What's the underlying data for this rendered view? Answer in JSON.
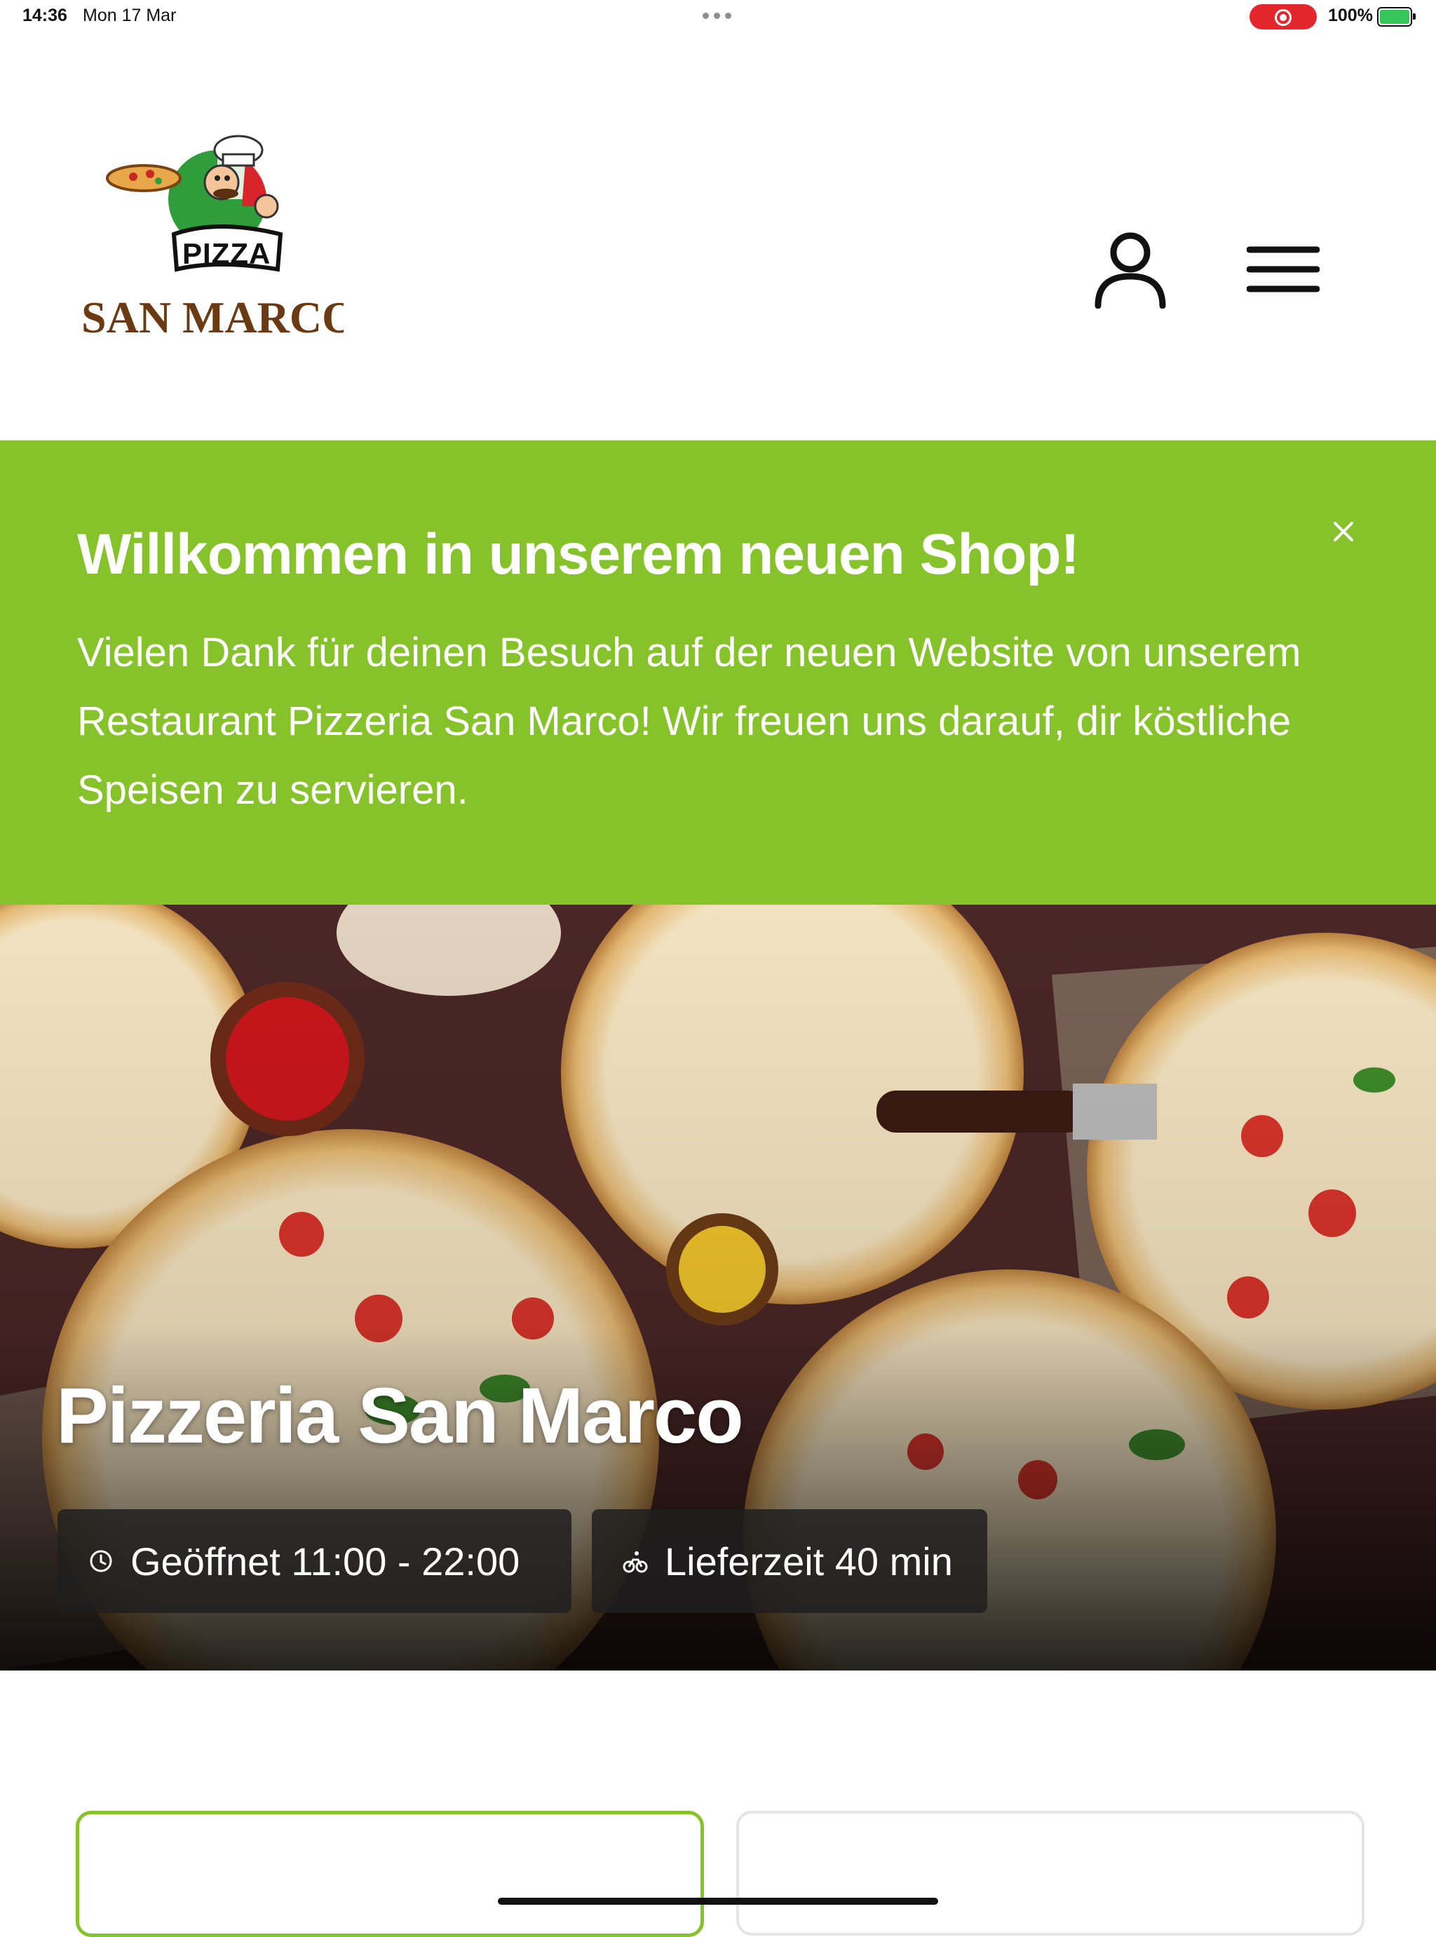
{
  "status_bar": {
    "time": "14:36",
    "date": "Mon 17 Mar",
    "battery": "100%"
  },
  "header": {
    "logo": {
      "top_text": "PIZZA",
      "bottom_text": "SAN MARCO"
    },
    "account_icon": "user-icon",
    "menu_icon": "hamburger-menu-icon"
  },
  "banner": {
    "title": "Willkommen in unserem neuen Shop!",
    "text": "Vielen Dank für deinen Besuch auf der neuen Website von unserem Restaurant Pizzeria San Marco! Wir freuen uns darauf, dir köstliche Speisen zu servieren.",
    "close_icon": "close-icon",
    "background": "#86c22a"
  },
  "hero": {
    "title": "Pizzeria San Marco",
    "opening_hours": "Geöffnet 11:00 - 22:00",
    "delivery_time": "Lieferzeit 40 min",
    "opening_icon": "clock-icon",
    "delivery_icon": "bicycle-icon"
  },
  "colors": {
    "accent": "#86c22a",
    "pill_background": "#1e1e1e",
    "record_indicator": "#e3262c"
  }
}
